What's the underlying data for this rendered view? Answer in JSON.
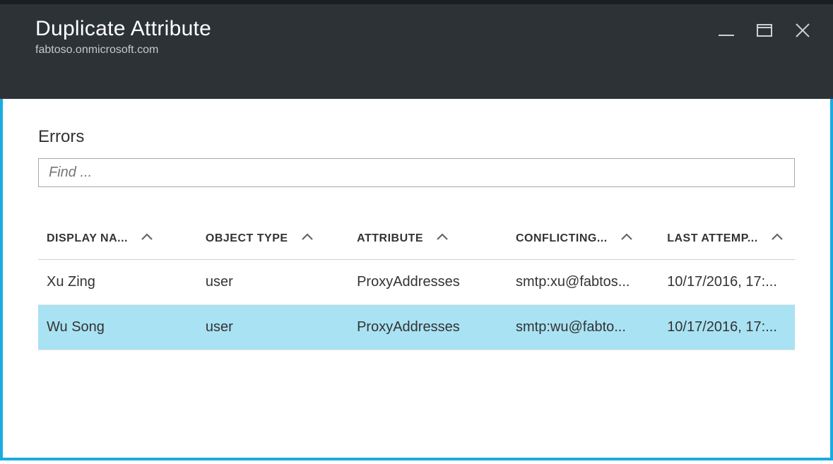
{
  "header": {
    "title": "Duplicate Attribute",
    "subtitle": "fabtoso.onmicrosoft.com"
  },
  "section": {
    "title": "Errors"
  },
  "search": {
    "placeholder": "Find ..."
  },
  "table": {
    "columns": [
      {
        "label": "DISPLAY NA..."
      },
      {
        "label": "OBJECT TYPE"
      },
      {
        "label": "ATTRIBUTE"
      },
      {
        "label": "CONFLICTING..."
      },
      {
        "label": "LAST ATTEMP..."
      }
    ],
    "rows": [
      {
        "display_name": "Xu Zing",
        "object_type": "user",
        "attribute": "ProxyAddresses",
        "conflicting": "smtp:xu@fabtos...",
        "last_attempt": "10/17/2016, 17:..."
      },
      {
        "display_name": "Wu Song",
        "object_type": "user",
        "attribute": "ProxyAddresses",
        "conflicting": "smtp:wu@fabto...",
        "last_attempt": "10/17/2016, 17:..."
      }
    ]
  }
}
